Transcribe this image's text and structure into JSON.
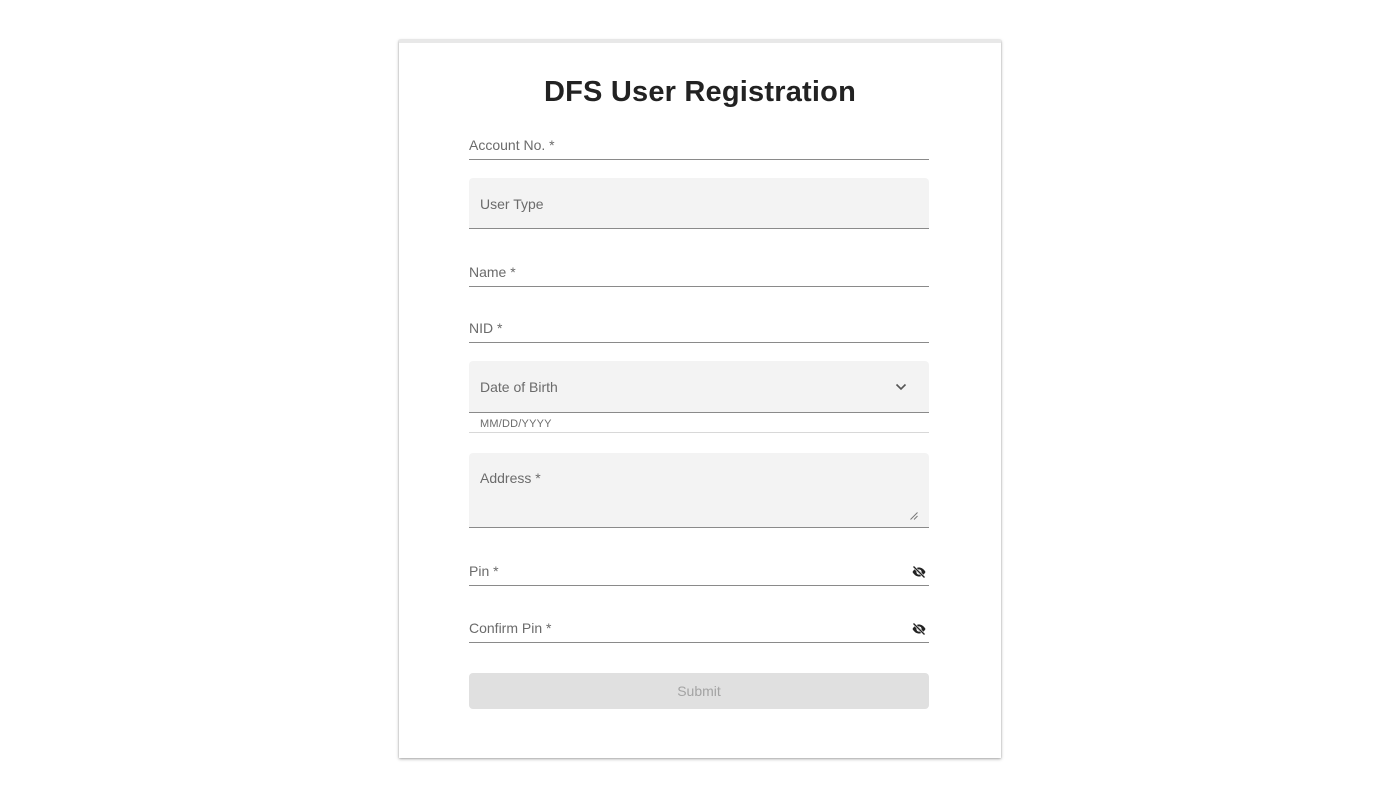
{
  "form": {
    "title": "DFS User Registration",
    "account_no_label": "Account No. *",
    "user_type_label": "User Type",
    "name_label": "Name *",
    "nid_label": "NID *",
    "dob_label": "Date of Birth",
    "dob_hint": "MM/DD/YYYY",
    "address_label": "Address *",
    "pin_label": "Pin *",
    "confirm_pin_label": "Confirm Pin *",
    "submit_label": "Submit"
  },
  "icons": {
    "dob_dropdown": "chevron-down-icon",
    "pin_visibility": "eye-off-icon",
    "confirm_pin_visibility": "eye-off-icon",
    "address_resize": "resize-handle-icon"
  },
  "colors": {
    "filled_background": "#f3f3f3",
    "submit_disabled_background": "#e0e0e0",
    "submit_disabled_text": "#a3a3a3",
    "label_text": "#6b6b6b"
  }
}
